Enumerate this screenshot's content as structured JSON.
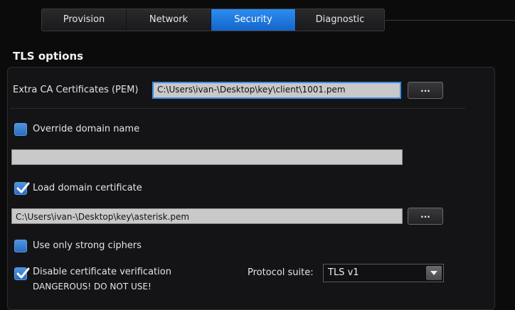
{
  "tabs": [
    {
      "label": "Provision",
      "active": false
    },
    {
      "label": "Network",
      "active": false
    },
    {
      "label": "Security",
      "active": true
    },
    {
      "label": "Diagnostic",
      "active": false
    }
  ],
  "section": {
    "title": "TLS options"
  },
  "extra_ca": {
    "label": "Extra CA Certificates (PEM)",
    "value": "C:\\Users\\ivan-\\Desktop\\key\\client\\1001.pem",
    "browse_label": "..."
  },
  "override_domain": {
    "label": "Override domain name",
    "checked": false,
    "value": ""
  },
  "load_domain_cert": {
    "label": "Load domain certificate",
    "checked": true,
    "value": "C:\\Users\\ivan-\\Desktop\\key\\asterisk.pem",
    "browse_label": "..."
  },
  "strong_ciphers": {
    "label": "Use only strong ciphers",
    "checked": false
  },
  "disable_verification": {
    "label": "Disable certificate verification",
    "warning": "DANGEROUS! DO NOT USE!",
    "checked": true
  },
  "protocol_suite": {
    "label": "Protocol suite:",
    "value": "TLS v1"
  },
  "colors": {
    "accent": "#1f7be0",
    "field_bg": "#c9c9c9",
    "background": "#0b0b0c"
  }
}
